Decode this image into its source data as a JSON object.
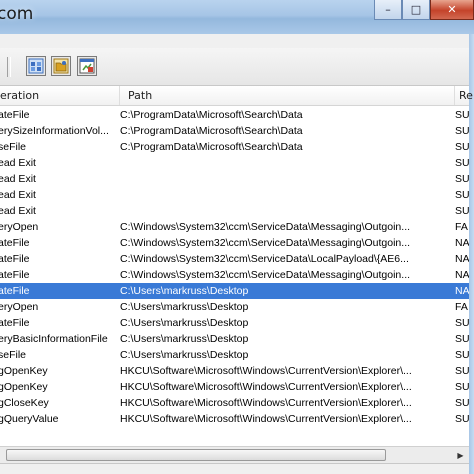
{
  "window": {
    "title": "com",
    "minimize_glyph": "–",
    "maximize_glyph": "□",
    "close_glyph": "✕"
  },
  "toolbar": {
    "buttons": [
      {
        "icon": "registry-filter-icon",
        "color": "#3c6fc0"
      },
      {
        "icon": "filesystem-filter-icon",
        "color": "#d8a020"
      },
      {
        "icon": "process-filter-icon",
        "color": "#4a9a3a"
      }
    ]
  },
  "columns": {
    "operation": "eration",
    "path": "Path",
    "result": "Re"
  },
  "rows": [
    {
      "op": "ateFile",
      "path": "C:\\ProgramData\\Microsoft\\Search\\Data",
      "res": "SU"
    },
    {
      "op": "erySizeInformationVol...",
      "path": "C:\\ProgramData\\Microsoft\\Search\\Data",
      "res": "SU"
    },
    {
      "op": "seFile",
      "path": "C:\\ProgramData\\Microsoft\\Search\\Data",
      "res": "SU"
    },
    {
      "op": "ead Exit",
      "path": "",
      "res": "SU"
    },
    {
      "op": "ead Exit",
      "path": "",
      "res": "SU"
    },
    {
      "op": "ead Exit",
      "path": "",
      "res": "SU"
    },
    {
      "op": "ead Exit",
      "path": "",
      "res": "SU"
    },
    {
      "op": "eryOpen",
      "path": "C:\\Windows\\System32\\ccm\\ServiceData\\Messaging\\Outgoin...",
      "res": "FA"
    },
    {
      "op": "ateFile",
      "path": "C:\\Windows\\System32\\ccm\\ServiceData\\Messaging\\Outgoin...",
      "res": "NA"
    },
    {
      "op": "ateFile",
      "path": "C:\\Windows\\System32\\ccm\\ServiceData\\LocalPayload\\{AE6...",
      "res": "NA"
    },
    {
      "op": "ateFile",
      "path": "C:\\Windows\\System32\\ccm\\ServiceData\\Messaging\\Outgoin...",
      "res": "NA"
    },
    {
      "op": "ateFile",
      "path": "C:\\Users\\markruss\\Desktop",
      "res": "NA",
      "selected": true
    },
    {
      "op": "eryOpen",
      "path": "C:\\Users\\markruss\\Desktop",
      "res": "FA"
    },
    {
      "op": "ateFile",
      "path": "C:\\Users\\markruss\\Desktop",
      "res": "SU"
    },
    {
      "op": "eryBasicInformationFile",
      "path": "C:\\Users\\markruss\\Desktop",
      "res": "SU"
    },
    {
      "op": "seFile",
      "path": "C:\\Users\\markruss\\Desktop",
      "res": "SU"
    },
    {
      "op": "gOpenKey",
      "path": "HKCU\\Software\\Microsoft\\Windows\\CurrentVersion\\Explorer\\...",
      "res": "SU"
    },
    {
      "op": "gOpenKey",
      "path": "HKCU\\Software\\Microsoft\\Windows\\CurrentVersion\\Explorer\\...",
      "res": "SU"
    },
    {
      "op": "gCloseKey",
      "path": "HKCU\\Software\\Microsoft\\Windows\\CurrentVersion\\Explorer\\...",
      "res": "SU"
    },
    {
      "op": "gQueryValue",
      "path": "HKCU\\Software\\Microsoft\\Windows\\CurrentVersion\\Explorer\\...",
      "res": "SU"
    },
    {
      "op": "",
      "path": "",
      "res": ""
    }
  ],
  "colors": {
    "selection": "#3a7ad6",
    "titlebar": "#a6c5e6"
  }
}
